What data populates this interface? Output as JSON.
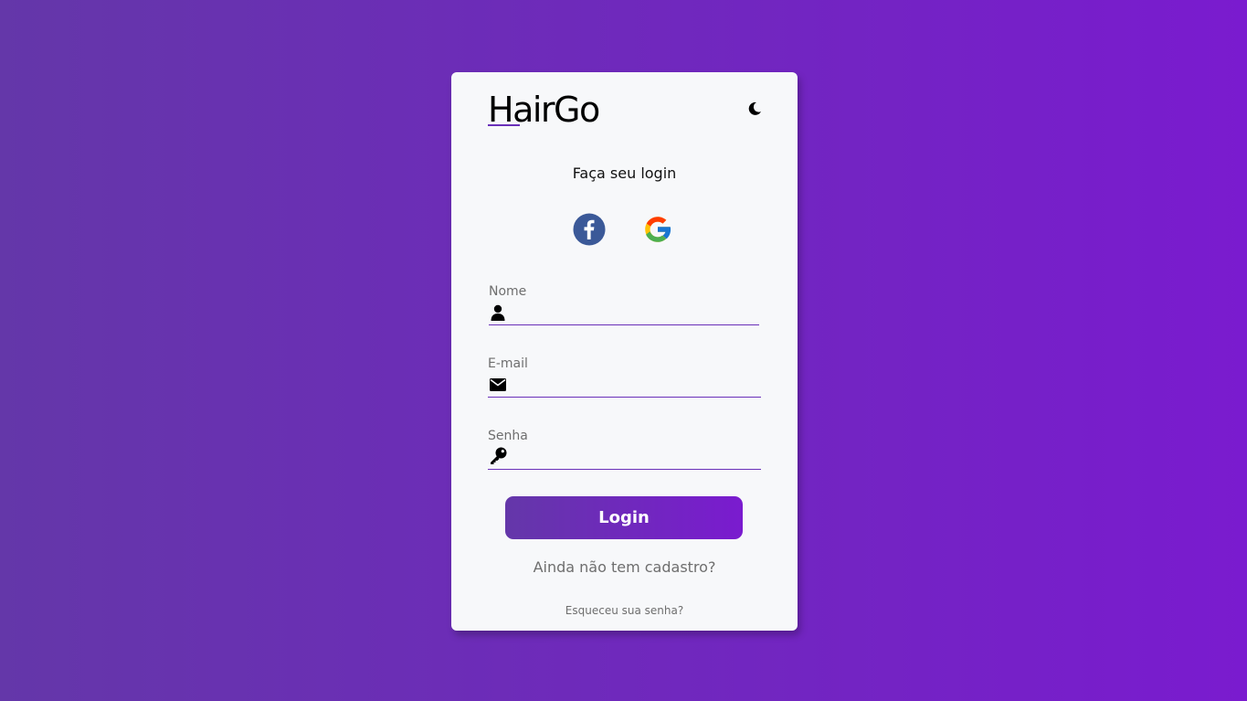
{
  "brand": {
    "name": "HairGo"
  },
  "theme_toggle": {
    "icon": "moon-icon"
  },
  "login_form": {
    "title": "Faça seu login",
    "social": [
      {
        "icon": "facebook-icon",
        "color": "#3b5998"
      },
      {
        "icon": "google-icon"
      }
    ],
    "fields": [
      {
        "label": "Nome",
        "icon": "user-icon",
        "value": "",
        "placeholder": ""
      },
      {
        "label": "E-mail",
        "icon": "envelope-icon",
        "value": "",
        "placeholder": ""
      },
      {
        "label": "Senha",
        "icon": "key-icon",
        "value": "",
        "placeholder": ""
      }
    ],
    "submit_label": "Login",
    "signup_link": "Ainda não tem cadastro?",
    "forgot_link": "Esqueceu sua senha?"
  },
  "colors": {
    "accent": "#6a30b9",
    "gradient_start": "#6437a9",
    "gradient_end": "#7a1bcf",
    "card_bg": "#f7f8fa"
  }
}
